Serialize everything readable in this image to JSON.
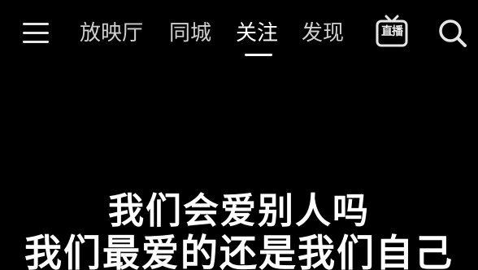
{
  "top_nav": {
    "tabs": [
      {
        "label": "放映厅"
      },
      {
        "label": "同城"
      },
      {
        "label": "关注",
        "active": true
      },
      {
        "label": "发现"
      }
    ],
    "live_button_label": "直播",
    "icons": {
      "menu": "hamburger-menu-icon",
      "live": "tv-icon",
      "search": "search-icon"
    }
  },
  "video_caption": {
    "line1": "我们会爱别人吗",
    "line2": "我们最爱的还是我们自己"
  },
  "colors": {
    "background": "#000000",
    "active_tab": "#ffffff",
    "inactive_tab": "#cfcfcf"
  }
}
